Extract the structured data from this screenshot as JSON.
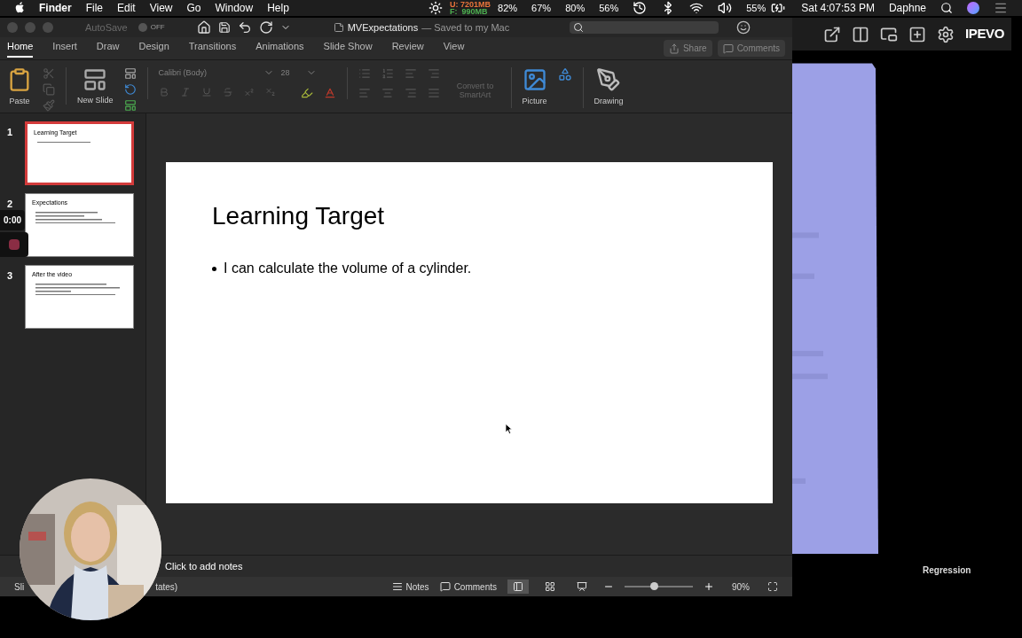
{
  "menu_bar": {
    "app": "Finder",
    "items": [
      "File",
      "Edit",
      "View",
      "Go",
      "Window",
      "Help"
    ],
    "memory": [
      {
        "text": "U: 7201MB",
        "color": "#e8743b"
      },
      {
        "text": "F:  990MB",
        "color": "#4caf50"
      }
    ],
    "meters": [
      "82%",
      "67%",
      "80%",
      "56%"
    ],
    "battery": "55%",
    "clock": "Sat 4:07:53 PM",
    "user": "Daphne"
  },
  "window": {
    "autosave": {
      "label": "AutoSave",
      "on": false,
      "state": "OFF"
    },
    "title": "MVExpectations",
    "subtitle": "— Saved to my Mac"
  },
  "tabs": [
    {
      "label": "Home",
      "selected": true
    },
    {
      "label": "Insert",
      "selected": false
    },
    {
      "label": "Draw",
      "selected": false
    },
    {
      "label": "Design",
      "selected": false
    },
    {
      "label": "Transitions",
      "selected": false
    },
    {
      "label": "Animations",
      "selected": false
    },
    {
      "label": "Slide Show",
      "selected": false
    },
    {
      "label": "Review",
      "selected": false
    },
    {
      "label": "View",
      "selected": false
    }
  ],
  "actions": [
    "Share",
    "Comments"
  ],
  "ribbon": {
    "paste": "Paste",
    "new_slide": "New Slide",
    "font_name": {
      "value": "Calibri (Body)",
      "disabled": true
    },
    "font_size": {
      "value": "28",
      "disabled": true
    },
    "convert": {
      "label": "Convert to SmartArt",
      "disabled": true
    },
    "picture": "Picture",
    "drawing": "Drawing"
  },
  "thumbnails": [
    {
      "number": "1",
      "selected": true,
      "title": "Learning Target"
    },
    {
      "number": "2",
      "selected": false,
      "title": "Expectations"
    },
    {
      "number": "3",
      "selected": false,
      "title": "After the video"
    }
  ],
  "slide": {
    "title": "Learning Target",
    "bullets": [
      "I can calculate the volume of a cylinder."
    ]
  },
  "notes": {
    "placeholder": "Click to add notes"
  },
  "status_bar": {
    "left": "Sli",
    "left_tail": "tates)",
    "buttons": [
      "Notes",
      "Comments"
    ],
    "views": [
      {
        "kind": "normal",
        "selected": true
      },
      {
        "kind": "sorter",
        "selected": false
      },
      {
        "kind": "reading",
        "selected": false
      }
    ],
    "zoom": {
      "level": 0.43,
      "reading": "90%"
    }
  },
  "recorder": {
    "timer": "0:00"
  },
  "camera_app": {
    "logo": "IPEVO",
    "caption": "Regression"
  }
}
